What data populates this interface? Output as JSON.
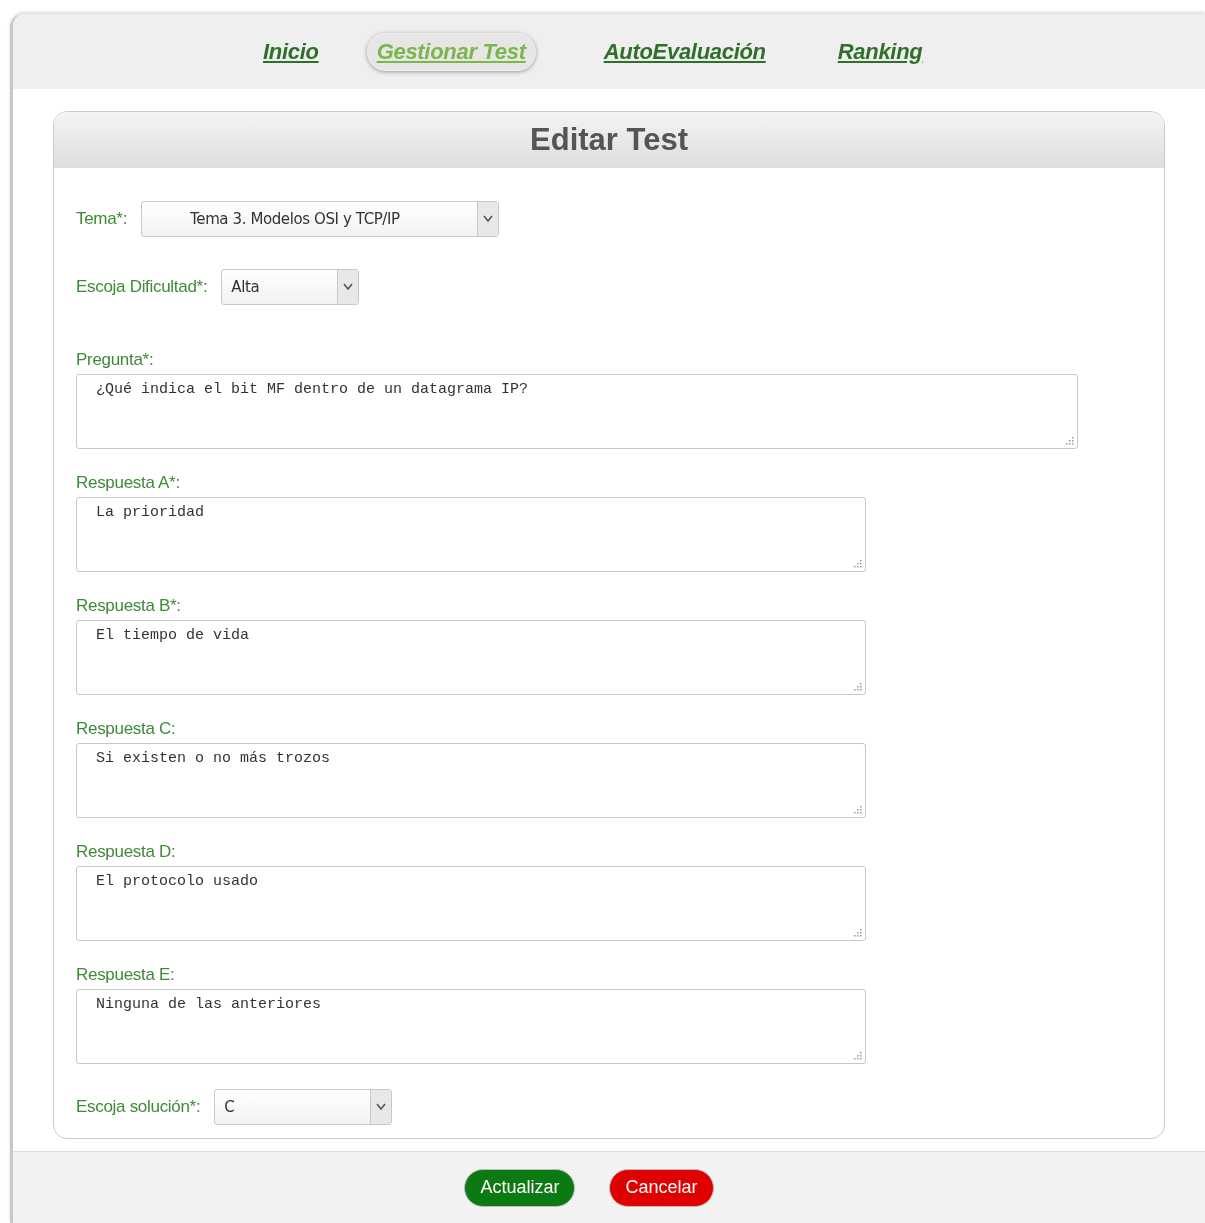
{
  "nav": [
    {
      "label": "Inicio",
      "selected": false
    },
    {
      "label": "Gestionar Test",
      "selected": true
    },
    {
      "label": "AutoEvaluación",
      "selected": false
    },
    {
      "label": "Ranking",
      "selected": false
    }
  ],
  "form": {
    "title": "Editar Test",
    "fields": [
      {
        "kind": "select",
        "label": "Tema*:",
        "value": "Tema 3. Modelos OSI y TCP/IP"
      },
      {
        "kind": "select",
        "label": "Escoja Dificultad*:",
        "value": "Alta"
      },
      {
        "kind": "textarea",
        "label": "Pregunta*:",
        "value": "¿Qué indica el bit MF dentro de un datagrama IP?"
      },
      {
        "kind": "textarea",
        "label": "Respuesta A*:",
        "value": "La prioridad"
      },
      {
        "kind": "textarea",
        "label": "Respuesta B*:",
        "value": "El tiempo de vida"
      },
      {
        "kind": "textarea",
        "label": "Respuesta C:",
        "value": "Si existen o no más trozos"
      },
      {
        "kind": "textarea",
        "label": "Respuesta D:",
        "value": "El protocolo usado"
      },
      {
        "kind": "textarea",
        "label": "Respuesta E:",
        "value": "Ninguna de las anteriores"
      },
      {
        "kind": "select",
        "label": "Escoja solución*:",
        "value": "C"
      }
    ]
  },
  "buttons": [
    {
      "kind": "primary",
      "label": "Actualizar"
    },
    {
      "kind": "danger",
      "label": "Cancelar"
    }
  ]
}
